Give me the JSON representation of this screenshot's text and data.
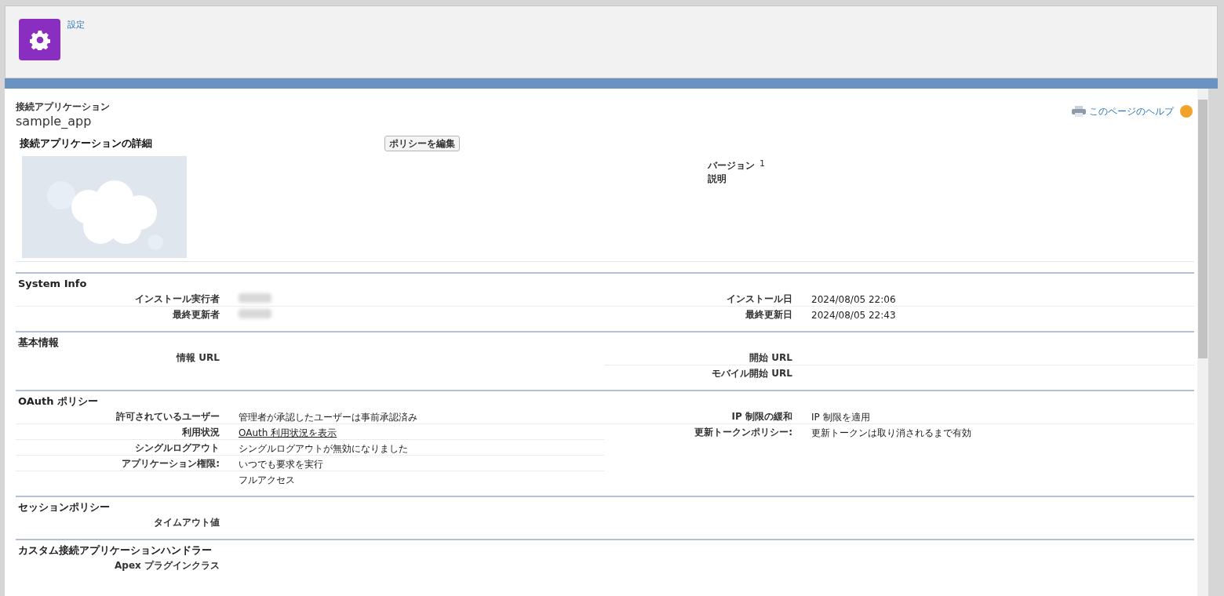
{
  "header": {
    "title": "設定"
  },
  "page": {
    "object_type": "接続アプリケーション",
    "name": "sample_app",
    "help_link": "このページのヘルプ"
  },
  "detail": {
    "title": "接続アプリケーションの詳細",
    "button": "ポリシーを編集",
    "fields": [
      {
        "label": "バージョン",
        "value": "1"
      },
      {
        "label": "説明"
      }
    ]
  },
  "sections": [
    {
      "title": "System Info",
      "left": [
        {
          "label": "インストール実行者",
          "kind": "redacted"
        },
        {
          "label": "最終更新者",
          "kind": "redacted"
        }
      ],
      "right": [
        {
          "label": "インストール日",
          "kind": "text",
          "value": "2024/08/05 22:06"
        },
        {
          "label": "最終更新日",
          "kind": "text",
          "value": "2024/08/05 22:43"
        }
      ]
    },
    {
      "title": "基本情報",
      "left": [
        {
          "label": "情報 URL",
          "kind": "text"
        }
      ],
      "right": [
        {
          "label": "開始 URL",
          "kind": "text"
        },
        {
          "label": "モバイル開始 URL",
          "kind": "text"
        }
      ]
    },
    {
      "title": "OAuth ポリシー",
      "left": [
        {
          "label": "許可されているユーザー",
          "kind": "text",
          "value": "管理者が承認したユーザーは事前承認済み"
        },
        {
          "label": "利用状況",
          "kind": "link",
          "value": "OAuth 利用状況を表示"
        },
        {
          "label": "シングルログアウト",
          "kind": "text",
          "value": "シングルログアウトが無効になりました"
        },
        {
          "label": "アプリケーション権限:",
          "kind": "text",
          "value": "いつでも要求を実行"
        },
        {
          "kind": "text",
          "value": "フルアクセス"
        }
      ],
      "right": [
        {
          "label": "IP 制限の緩和",
          "kind": "text",
          "value": "IP 制限を適用"
        },
        {
          "label": "更新トークンポリシー:",
          "kind": "text",
          "value": "更新トークンは取り消されるまで有効"
        }
      ]
    },
    {
      "title": "セッションポリシー",
      "left": [
        {
          "label": "タイムアウト値",
          "kind": "text"
        }
      ]
    },
    {
      "title": "カスタム接続アプリケーションハンドラー",
      "left": [
        {
          "label": "Apex プラグインクラス",
          "kind": "text"
        }
      ]
    }
  ]
}
